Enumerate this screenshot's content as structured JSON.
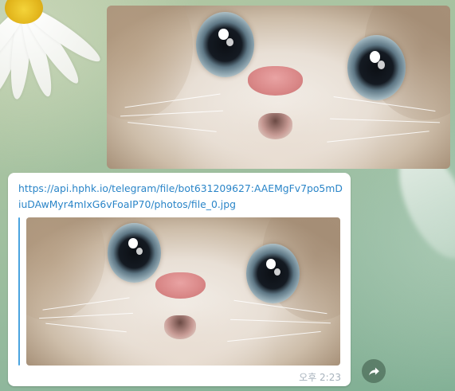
{
  "wallpaper": {
    "description_hidden": ""
  },
  "messages": [
    {
      "type": "photo"
    },
    {
      "type": "link_preview",
      "link_text": "https://api.hphk.io/telegram/file/bot631209627:AAEMgFv7po5mDiuDAwMyr4mIxG6vFoaIP70/photos/file_0.jpg",
      "time": "오후 2:23"
    }
  ],
  "icons": {
    "forward": "forward-arrow-icon"
  },
  "colors": {
    "link": "#2a85c8",
    "quote_bar": "#4aa3df",
    "time": "#a7b2bc",
    "bubble": "#ffffff"
  }
}
